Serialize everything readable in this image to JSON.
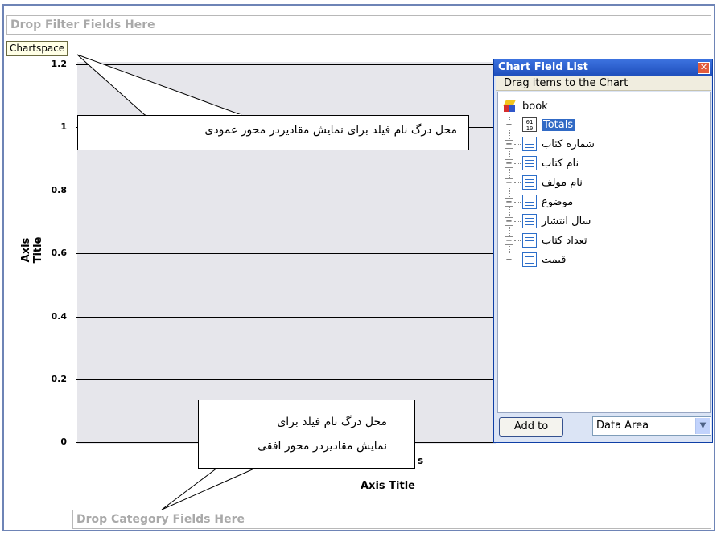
{
  "filter_zone": {
    "label": "Drop Filter Fields Here"
  },
  "category_zone": {
    "label": "Drop Category Fields Here"
  },
  "chartspace_label": "Chartspace",
  "axes": {
    "y_ticks": [
      "1.2",
      "1",
      "0.8",
      "0.6",
      "0.4",
      "0.2",
      "0"
    ],
    "y_title": "Axis Title",
    "x_title": "Axis Title",
    "x_fragment": "s"
  },
  "callouts": {
    "vertical_axis": "محل درگ نام فیلد برای نمایش مقادیردر محور عمودی",
    "horizontal_axis_line1": "محل درگ نام فیلد برای",
    "horizontal_axis_line2": "نمایش مقادیردر محور افقی"
  },
  "field_list": {
    "title": "Chart Field List",
    "close_icon": "close-icon",
    "subtitle": "Drag items to the Chart",
    "root": "book",
    "items": [
      {
        "label": "Totals",
        "icon": "totals-icon",
        "selected": true
      },
      {
        "label": "شماره کتاب",
        "icon": "field-icon"
      },
      {
        "label": "نام کتاب",
        "icon": "field-icon"
      },
      {
        "label": "نام مولف",
        "icon": "field-icon"
      },
      {
        "label": "موضوع",
        "icon": "field-icon"
      },
      {
        "label": "سال انتشار",
        "icon": "field-icon"
      },
      {
        "label": "تعداد کتاب",
        "icon": "field-icon"
      },
      {
        "label": "قیمت",
        "icon": "field-icon"
      }
    ],
    "add_button": "Add to",
    "area_select": "Data Area"
  },
  "colors": {
    "plot_background": "#e6e6eb",
    "panel_titlebar": "#1f4fbc",
    "selection": "#316ac5"
  }
}
